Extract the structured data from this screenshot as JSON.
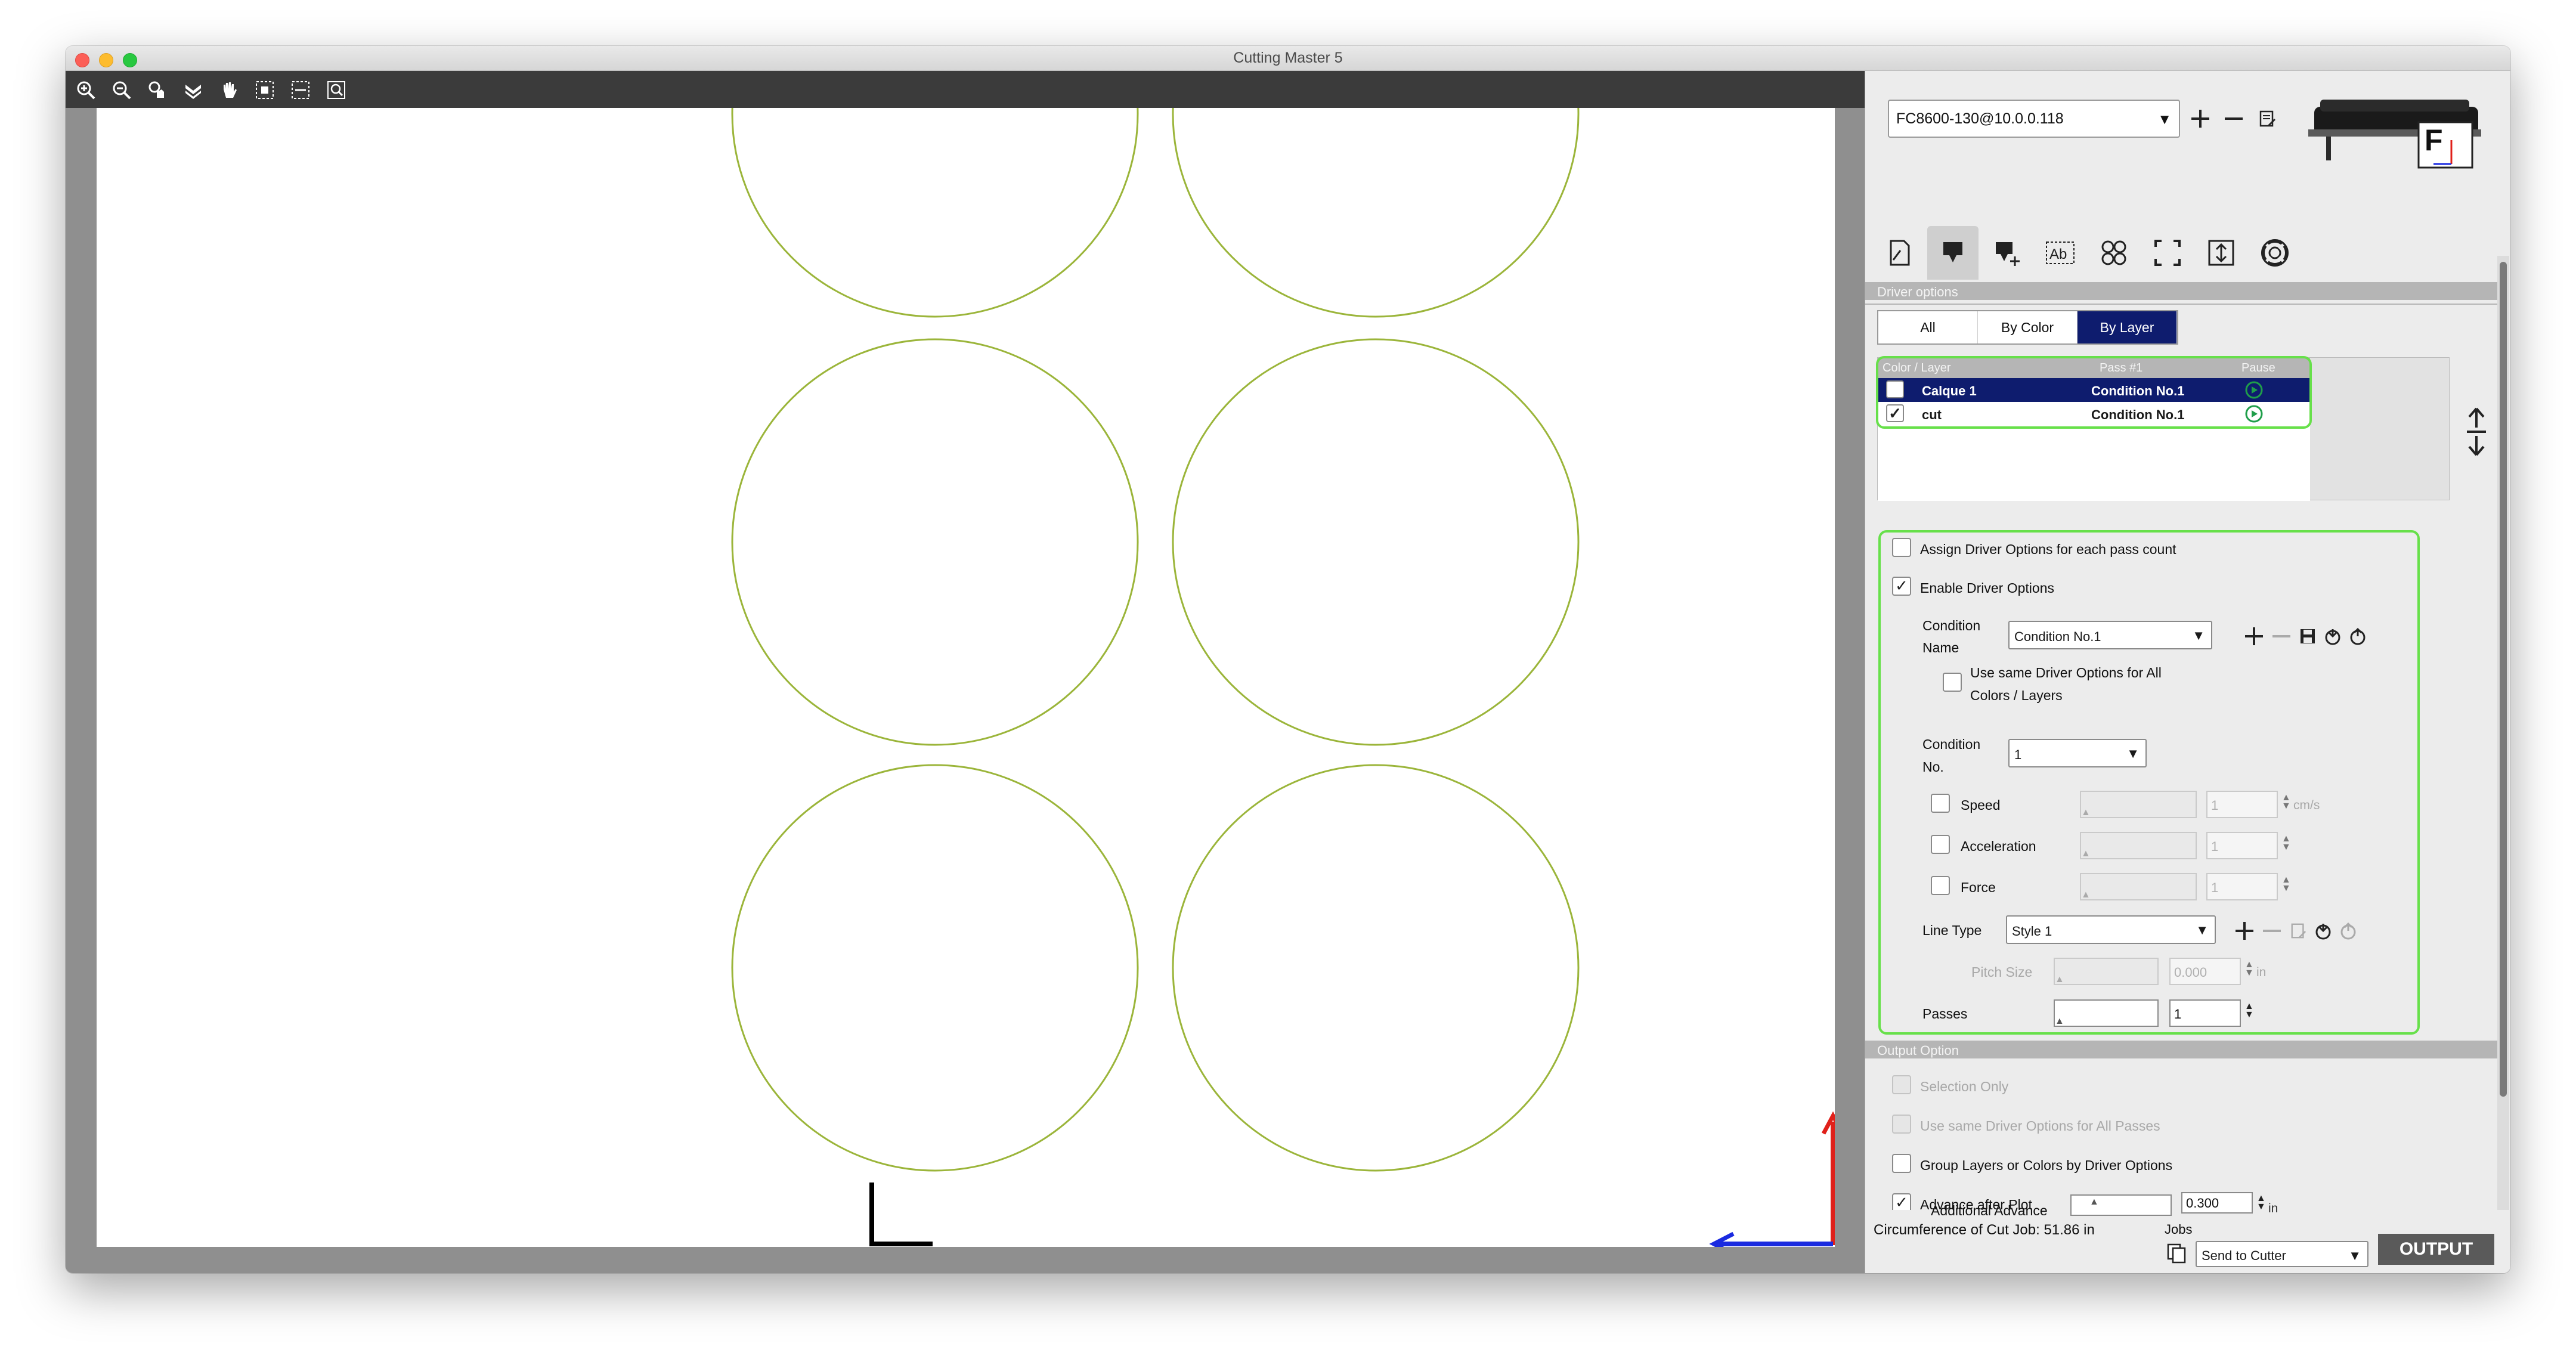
{
  "window": {
    "title": "Cutting Master 5"
  },
  "toolbar": {
    "icons": [
      "zoom-in-icon",
      "zoom-out-icon",
      "zoom-hand-icon",
      "move-down-icon",
      "pan-hand-icon",
      "fit-selection-icon",
      "fit-page-icon",
      "zoom-box-icon"
    ]
  },
  "device": {
    "selected": "FC8600-130@10.0.0.118"
  },
  "tabs": [
    "page-tab",
    "driver-options-tab",
    "tool-options-tab",
    "text-tab",
    "tile-tab",
    "registration-tab",
    "output-settings-tab",
    "support-tab"
  ],
  "driver_options": {
    "header": "Driver options",
    "segments": [
      "All",
      "By Color",
      "By Layer"
    ],
    "active_segment": "By Layer",
    "table_headers": {
      "layer": "Color / Layer",
      "pass": "Pass #1",
      "pause": "Pause"
    },
    "rows": [
      {
        "name": "Calque 1",
        "condition": "Condition No.1",
        "checked": false,
        "selected": true
      },
      {
        "name": "cut",
        "condition": "Condition No.1",
        "checked": true,
        "selected": false
      }
    ],
    "assign_each_pass": "Assign Driver Options for each pass count",
    "enable_driver_options": "Enable Driver Options",
    "condition_name_label_1": "Condition",
    "condition_name_label_2": "Name",
    "condition_name_value": "Condition No.1",
    "use_same_1": "Use same Driver Options for All",
    "use_same_2": "Colors / Layers",
    "condition_no_label_1": "Condition",
    "condition_no_label_2": "No.",
    "condition_no_value": "1",
    "speed_label": "Speed",
    "speed_value": "1",
    "speed_unit": "cm/s",
    "acceleration_label": "Acceleration",
    "acceleration_value": "1",
    "force_label": "Force",
    "force_value": "1",
    "line_type_label": "Line Type",
    "line_type_value": "Style 1",
    "pitch_size_label": "Pitch Size",
    "pitch_size_value": "0.000",
    "pitch_unit": "in",
    "passes_label": "Passes",
    "passes_value": "1"
  },
  "output_option": {
    "header": "Output Option",
    "selection_only": "Selection Only",
    "use_same_all_passes": "Use same Driver Options for All Passes",
    "group_layers": "Group Layers or Colors by Driver Options",
    "advance_after_plot": "Advance after Plot",
    "additional_advance_label": "Additional Advance",
    "additional_advance_value": "0.300",
    "additional_advance_unit": "in"
  },
  "footer": {
    "circumference": "Circumference of Cut Job: 51.86 in",
    "jobs_label": "Jobs",
    "jobs_value": "Send to Cutter",
    "output_label": "OUTPUT"
  },
  "colors": {
    "accent": "#0e1c6e",
    "highlight_outline": "#67e04a",
    "circle_stroke": "#9bb53a",
    "origin_y_arrow": "#e0201a",
    "origin_x_arrow": "#1a2ae0"
  }
}
